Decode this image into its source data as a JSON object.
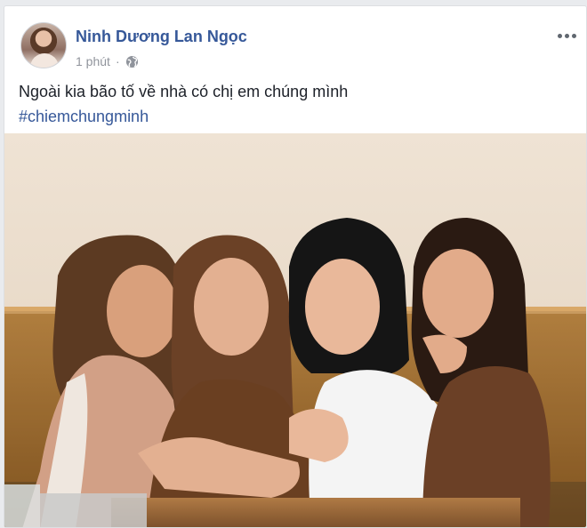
{
  "post": {
    "author_name": "Ninh Dương Lan Ngọc",
    "timestamp": "1 phút",
    "separator": "·",
    "privacy_icon": "globe-icon",
    "text": "Ngoài kia bão tố về nhà có chị em chúng mình",
    "hashtag": "#chiemchungminh",
    "more_icon": "more-options-icon"
  },
  "colors": {
    "link": "#365899",
    "meta": "#90949c",
    "text": "#1d2129",
    "background": "#e9ebee"
  }
}
